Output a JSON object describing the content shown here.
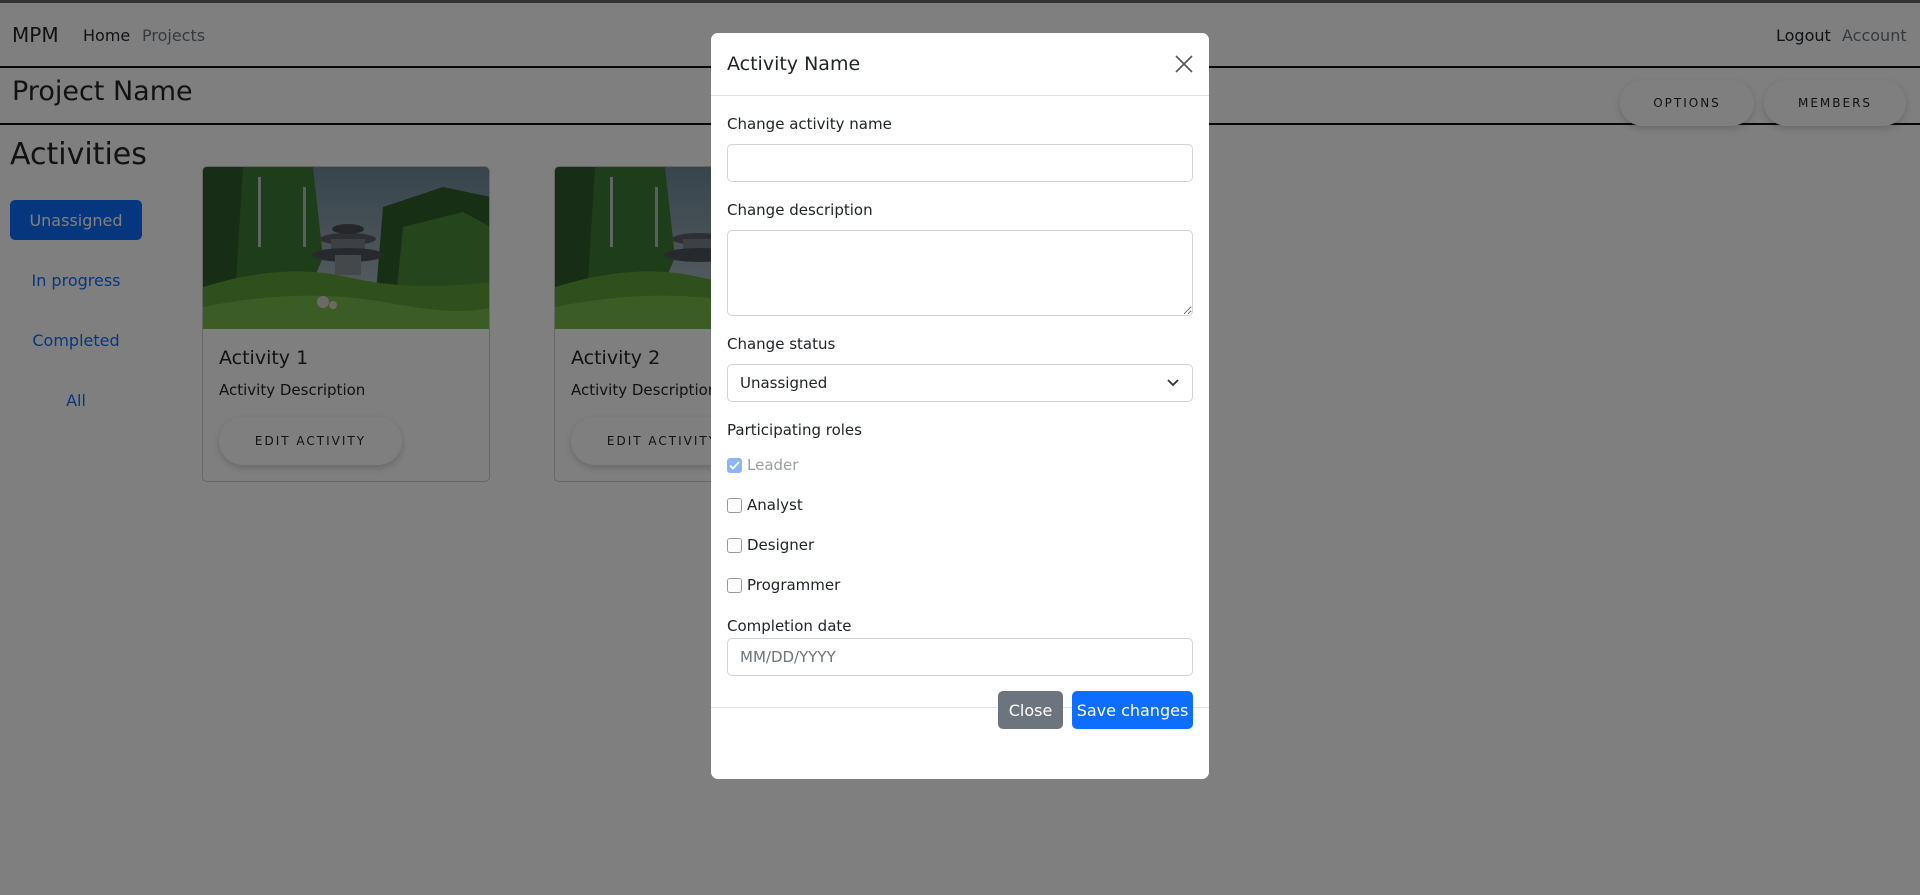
{
  "navbar": {
    "brand": "MPM",
    "home": "Home",
    "projects": "Projects",
    "logout": "Logout",
    "account": "Account"
  },
  "project": {
    "title": "Project Name",
    "options_label": "OPTIONS",
    "members_label": "MEMBERS"
  },
  "activities": {
    "title": "Activities",
    "filters": [
      {
        "label": "Unassigned",
        "active": true
      },
      {
        "label": "In progress",
        "active": false
      },
      {
        "label": "Completed",
        "active": false
      },
      {
        "label": "All",
        "active": false
      }
    ],
    "cards": [
      {
        "title": "Activity 1",
        "description": "Activity Description",
        "button": "EDIT ACTIVITY"
      },
      {
        "title": "Activity 2",
        "description": "Activity Description",
        "button": "EDIT ACTIVITY"
      }
    ]
  },
  "modal": {
    "title": "Activity Name",
    "name_label": "Change activity name",
    "name_value": "",
    "description_label": "Change description",
    "description_value": "",
    "status_label": "Change status",
    "status_value": "Unassigned",
    "roles_label": "Participating roles",
    "roles": [
      {
        "label": "Leader",
        "checked": true,
        "disabled": true
      },
      {
        "label": "Analyst",
        "checked": false,
        "disabled": false
      },
      {
        "label": "Designer",
        "checked": false,
        "disabled": false
      },
      {
        "label": "Programmer",
        "checked": false,
        "disabled": false
      }
    ],
    "date_label": "Completion date",
    "date_placeholder": "MM/DD/YYYY",
    "close_label": "Close",
    "save_label": "Save changes"
  },
  "colors": {
    "primary": "#0d6efd",
    "secondary": "#6c757d",
    "backdrop": "rgba(0,0,0,0.5)"
  },
  "icons": {
    "modal_close": "close-icon",
    "select": "chevron-down-icon",
    "checkbox": "check-icon"
  }
}
